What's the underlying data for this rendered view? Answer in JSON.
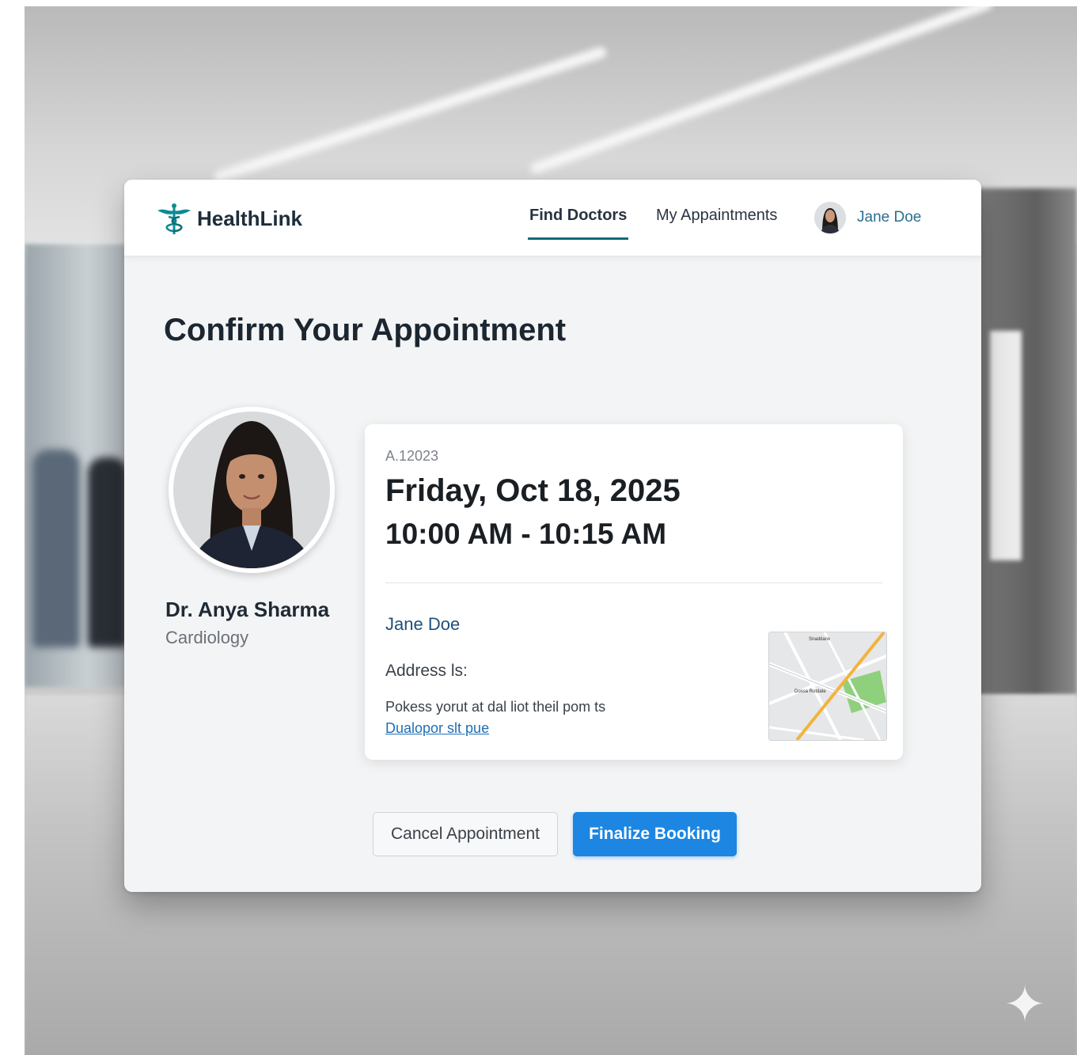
{
  "brand": {
    "name": "HealthLink",
    "accent": "#0e8a94"
  },
  "nav": {
    "find_doctors": "Find Doctors",
    "my_appointments": "My Appaintments",
    "user_name": "Jane Doe"
  },
  "page": {
    "title": "Confirm Your Appointment"
  },
  "doctor": {
    "name": "Dr. Anya Sharma",
    "specialty": "Cardiology"
  },
  "appointment": {
    "reference": "A.12023",
    "date": "Friday, Oct 18, 2025",
    "time": "10:00 AM - 10:15 AM",
    "patient": "Jane Doe",
    "address_label": "Address ls:",
    "address_text": "Pokess yorut at dal liot theil pom ts",
    "address_link": "Dualopor slt pue"
  },
  "map": {
    "labels": [
      "Snaddanx",
      "Dossa Rotdate"
    ],
    "colors": {
      "road_major": "#f2b33d",
      "park": "#8fd07c",
      "road_minor": "#ffffff"
    }
  },
  "actions": {
    "cancel": "Cancel Appointment",
    "finalize": "Finalize Booking",
    "finalize_color": "#1c86e2"
  }
}
